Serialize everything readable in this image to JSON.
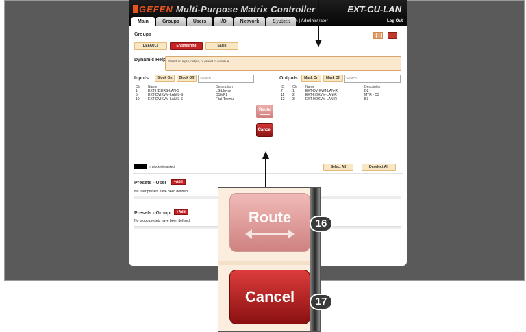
{
  "header": {
    "brand": "GEFEN",
    "app_title": "Multi-Purpose Matrix Controller",
    "device_model": "EXT-CU-LAN",
    "tabs": [
      {
        "label": "Main",
        "active": true
      },
      {
        "label": "Groups",
        "active": false
      },
      {
        "label": "Users",
        "active": false
      },
      {
        "label": "I/O",
        "active": false
      },
      {
        "label": "Network",
        "active": false
      },
      {
        "label": "System",
        "active": false
      }
    ],
    "user_info": "User: admin  |  Administrator",
    "logout": "Log Out"
  },
  "groups": {
    "title": "Groups",
    "items": [
      {
        "label": "DEFAULT",
        "selected": false
      },
      {
        "label": "Engineering",
        "selected": true
      },
      {
        "label": "Sales",
        "selected": false
      }
    ],
    "view_icons": [
      "grid-view-icon",
      "list-view-icon"
    ]
  },
  "dynamic_help": {
    "label": "Dynamic Help:",
    "text": "Select an input, output, or preset to continue."
  },
  "inputs": {
    "title": "Inputs",
    "block_on": "Block On",
    "block_off": "Block Off",
    "search_placeholder": "Search",
    "columns": [
      "Ch",
      "Name",
      "Description"
    ],
    "rows": [
      {
        "ch": "1",
        "name": "EXT-HD2IRS-LAN-S",
        "desc": "LG blu-ray"
      },
      {
        "ch": "5",
        "name": "EXT-DVIKVM-LAN-L-S",
        "desc": "DSMP2"
      },
      {
        "ch": "10",
        "name": "EXT-DVIKVM-LAN-L-S",
        "desc": "Fitzi-Teemu"
      }
    ]
  },
  "outputs": {
    "title": "Outputs",
    "mask_on": "Mask On",
    "mask_off": "Mask Off",
    "search_placeholder": "Search",
    "columns": [
      "ID",
      "Ch",
      "Name",
      "Description"
    ],
    "rows": [
      {
        "id": "7",
        "ch": "1",
        "name": "EXT-DVIKVM-LAN-R",
        "desc": "D2"
      },
      {
        "id": "11",
        "ch": "2",
        "name": "EXT-HDKVM-LAN-R",
        "desc": "MTR - D3"
      },
      {
        "id": "12",
        "ch": "3",
        "name": "EXT-HDKVM-LAN-R",
        "desc": "B3"
      }
    ],
    "select_all": "Select All",
    "deselect_all": "Deselect All"
  },
  "actions": {
    "route": "Route",
    "cancel": "Cancel"
  },
  "legend": {
    "text": "= Blocked/Masked"
  },
  "presets_user": {
    "title": "Presets - User",
    "add": "+Add",
    "empty": "No user presets have been defined."
  },
  "presets_group": {
    "title": "Presets - Group",
    "add": "+Add",
    "empty": "No group presets have been defined."
  },
  "zoom": {
    "route_label": "Route",
    "cancel_label": "Cancel",
    "callout_route": "16",
    "callout_cancel": "17"
  },
  "colors": {
    "accent": "#c72222",
    "brand_orange": "#e6541f",
    "button_bg": "#f9e6c2",
    "help_bg": "#fbe9cf"
  }
}
